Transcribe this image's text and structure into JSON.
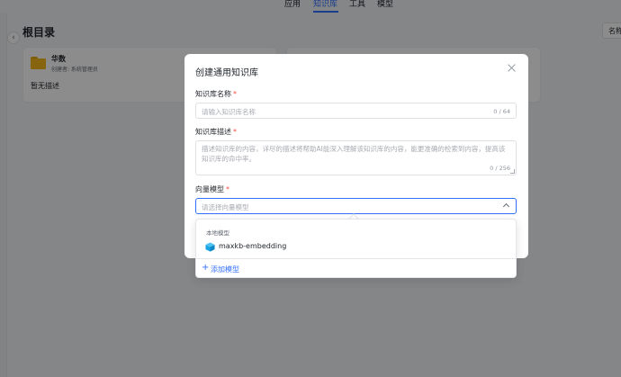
{
  "topnav": {
    "tabs": [
      {
        "label": "应用",
        "active": false
      },
      {
        "label": "知识库",
        "active": true
      },
      {
        "label": "工具",
        "active": false
      },
      {
        "label": "模型",
        "active": false
      }
    ]
  },
  "page": {
    "title": "根目录",
    "sort_label": "名称"
  },
  "cards": [
    {
      "name": "华数",
      "creator": "创建者: 系统管理员",
      "desc": "暂无描述"
    }
  ],
  "dialog": {
    "title": "创建通用知识库",
    "name_field": {
      "label": "知识库名称",
      "placeholder": "请输入知识库名称",
      "count": "0 / 64"
    },
    "desc_field": {
      "label": "知识库描述",
      "placeholder": "描述知识库的内容，详尽的描述将帮助AI能深入理解该知识库的内容，能更准确的检索到内容，提高该知识库的命中率。",
      "count": "0 / 256"
    },
    "model_field": {
      "label": "向量模型",
      "placeholder": "请选择向量模型"
    }
  },
  "dropdown": {
    "group_label": "本地模型",
    "options": [
      {
        "label": "maxkb-embedding",
        "icon": "cube-icon"
      }
    ],
    "add_label": "添加模型"
  },
  "colors": {
    "accent": "#3370ff",
    "required": "#f54a45",
    "folder": "#f5b81b",
    "model_icon": "#1aa5e6"
  }
}
